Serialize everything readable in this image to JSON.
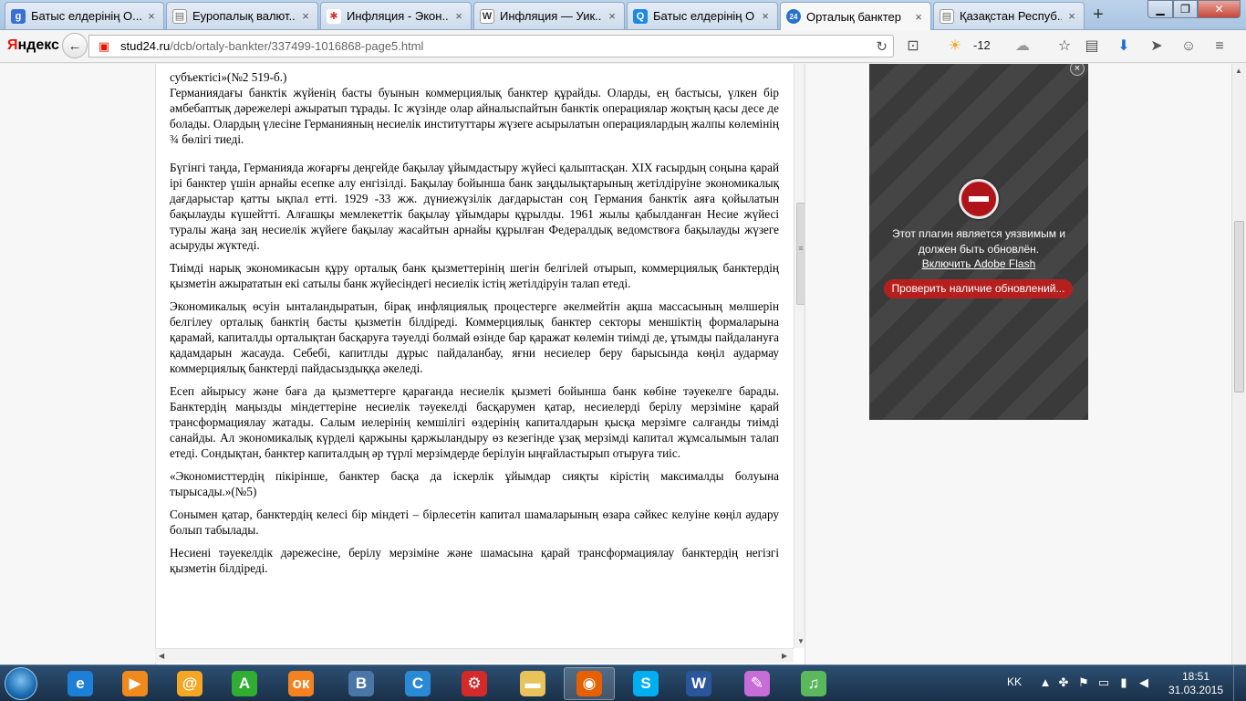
{
  "tabs": [
    {
      "label": "Батыс елдерінің О...",
      "icon": "google-icon",
      "icon_text": "g",
      "color": "#3a70d4"
    },
    {
      "label": "Еуропалық валют...",
      "icon": "document-icon",
      "icon_text": "▤",
      "color": "#888888"
    },
    {
      "label": "Инфляция - Экон...",
      "icon": "pinwheel-icon",
      "icon_text": "✱",
      "color": "#d73030"
    },
    {
      "label": "Инфляция — Уик...",
      "icon": "wikipedia-icon",
      "icon_text": "W",
      "color": "#555555"
    },
    {
      "label": "Батыс елдерінің О...",
      "icon": "search-icon",
      "icon_text": "Q",
      "color": "#1e88e5"
    },
    {
      "label": "Орталық банктер",
      "icon": "site-24-icon",
      "icon_text": "24",
      "color": "#2a72c9"
    },
    {
      "label": "Қазақстан Респуб...",
      "icon": "document-icon",
      "icon_text": "▤",
      "color": "#888888"
    }
  ],
  "nav": {
    "logo_first": "Я",
    "logo_rest": "ндекс",
    "url_domain": "stud24.ru",
    "url_path": "/dcb/ortaly-bankter/337499-1016868-page5.html",
    "temperature": "-12"
  },
  "document": {
    "fragment_top": "субъектісі»(№2 519-б.)",
    "paragraphs": [
      "Германиядағы банктік жүйенің басты буынын коммерциялық банктер құрайды. Оларды, ең бастысы, үлкен бір әмбебаптық дәрежелері ажыратып тұрады. Іс жүзінде олар айналыспайтын банктік операциялар жоқтың қасы десе де болады. Олардың үлесіне Германияның несиелік институттары жүзеге асырылатын операциялардың жалпы көлемінің ¾ бөлігі тиеді.",
      "Бүгінгі таңда, Германияда жоғарғы деңгейде бақылау ұйымдастыру жүйесі қалыптасқан. XIX ғасырдың соңына қарай ірі банктер үшін арнайы есепке алу енгізілді. Бақылау бойынша банк заңдылықтарының жетілдіруіне экономикалық дағдарыстар қатты ықпал етті. 1929 -33 жж. дүниежүзілік дағдарыстан соң Германия банктік аяға қойылатын бақылауды күшейтті. Алғашқы мемлекеттік бақылау ұйымдары құрылды. 1961 жылы қабылданған Несие жүйесі туралы жаңа заң несиелік жүйеге бақылау жасайтын арнайы құрылған Федералдық ведомствоға бақылауды жүзеге асыруды жүктеді.",
      "Тиімді нарық экономикасын құру орталық банк қызметтерінің шегін белгілей отырып, коммерциялық банктердің қызметін ажырататын екі сатылы банк жүйесіндегі несиелік істің жетілдіруін талап етеді.",
      "Экономикалық өсуін ынталандыратын, бірақ инфляциялық процестерге әкелмейтін ақша массасының мөлшерін белгілеу орталық банктің басты қызметін білдіреді. Коммерциялық банктер секторы меншіктің формаларына қарамай, капиталды орталықтан басқаруға тәуелді болмай өзінде бар қаражат көлемін тиімді де, ұтымды пайдалануға қадамдарын жасауда. Себебі, капитлды дұрыс пайдаланбау, яғни несиелер беру барысында көңіл аудармау коммерциялық банктерді пайдасыздыққа әкеледі.",
      "Есеп айырысу және баға да қызметтерге қарағанда несиелік қызметі бойынша банк көбіне тәуекелге барады. Банктердің маңызды міндеттеріне несиелік тәуекелді басқарумен қатар, несиелерді берілу мерзіміне қарай трансформациялау жатады. Салым иелерінің кемшілігі өздерінің капиталдарын қысқа мерзімге салғанды тиімді санайды. Ал экономикалық күрделі қаржыны қаржыландыру өз кезегінде ұзақ мерзімді капитал жұмсалымын талап етеді. Сондықтан, банктер капиталдың әр түрлі мерзімдерде берілуін ыңғайластырып отыруға тиіс.",
      "«Экономисттердің пікірінше, банктер басқа да іскерлік ұйымдар сияқты кірістің максималды болуына тырысады.»(№5)",
      "Сонымен қатар, банктердің келесі бір міндеті – бірлесетін капитал шамаларының өзара сәйкес келуіне көңіл аудару болып табылады.",
      "Несиені тәуекелдік дәрежесіне, берілу мерзіміне және шамасына қарай трансформациялау банктердің негізгі қызметін білдіреді."
    ]
  },
  "flash": {
    "message": "Этот плагин является уязвимым и должен быть обновлён.",
    "enable_link": "Включить Adobe Flash",
    "update_button": "Проверить наличие обновлений..."
  },
  "taskbar": {
    "apps": [
      {
        "icon": "internet-explorer-icon",
        "glyph": "e",
        "color": "#1e7fd6"
      },
      {
        "icon": "media-player-icon",
        "glyph": "▶",
        "color": "#f08a1c"
      },
      {
        "icon": "mail-agent-icon",
        "glyph": "@",
        "color": "#f5a623"
      },
      {
        "icon": "green-a-icon",
        "glyph": "A",
        "color": "#2fae32"
      },
      {
        "icon": "odnoklassniki-icon",
        "glyph": "ок",
        "color": "#f58220"
      },
      {
        "icon": "vk-icon",
        "glyph": "В",
        "color": "#4a76a8"
      },
      {
        "icon": "ccleaner-icon",
        "glyph": "C",
        "color": "#2a8ad6"
      },
      {
        "icon": "speed-tool-icon",
        "glyph": "⚙",
        "color": "#d42a2a"
      },
      {
        "icon": "file-explorer-icon",
        "glyph": "▬",
        "color": "#e8c25a"
      },
      {
        "icon": "firefox-icon",
        "glyph": "◉",
        "color": "#e66000"
      },
      {
        "icon": "skype-icon",
        "glyph": "S",
        "color": "#00aff0"
      },
      {
        "icon": "word-icon",
        "glyph": "W",
        "color": "#2b579a"
      },
      {
        "icon": "paint-icon",
        "glyph": "✎",
        "color": "#c86cd8"
      },
      {
        "icon": "music-icon",
        "glyph": "♫",
        "color": "#5cb85c"
      }
    ],
    "lang": "KK",
    "time": "18:51",
    "date": "31.03.2015"
  }
}
